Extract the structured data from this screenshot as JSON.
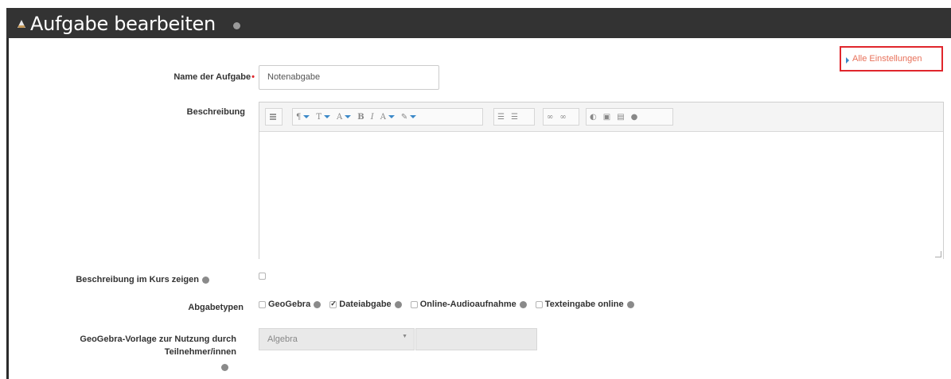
{
  "header": {
    "title": "Aufgabe bearbeiten",
    "icon": "assignment-icon",
    "help_icon": "help-icon"
  },
  "expand_link": {
    "label": "Alle Einstellungen"
  },
  "form": {
    "name": {
      "label": "Name der Aufgabe",
      "required_mark": "•",
      "value": "Notenabgabe"
    },
    "description": {
      "label": "Beschreibung",
      "toolbar": [
        "toggle-toolbar-icon",
        "paragraph-style-icon",
        "font-style-icon",
        "font-size-icon",
        "bold-icon",
        "italic-icon",
        "font-color-icon",
        "highlight-color-icon",
        "bullet-list-icon",
        "numbered-list-icon",
        "link-icon",
        "unlink-icon",
        "image-icon",
        "media-icon",
        "file-icon",
        "record-audio-icon"
      ]
    },
    "show_description": {
      "label": "Beschreibung im Kurs zeigen",
      "checked": false
    },
    "submission_types": {
      "label": "Abgabetypen",
      "options": [
        {
          "label": "GeoGebra",
          "checked": false
        },
        {
          "label": "Dateiabgabe",
          "checked": true
        },
        {
          "label": "Online-Audioaufnahme",
          "checked": false
        },
        {
          "label": "Texteingabe online",
          "checked": false
        }
      ]
    },
    "geogebra_template": {
      "label_line1": "GeoGebra-Vorlage zur Nutzung durch",
      "label_line2": "Teilnehmer/innen",
      "selected": "Algebra"
    }
  },
  "colors": {
    "title_bar": "#333333",
    "link": "#e8715a",
    "highlight_box": "#e0262c",
    "required": "#e0262c"
  }
}
